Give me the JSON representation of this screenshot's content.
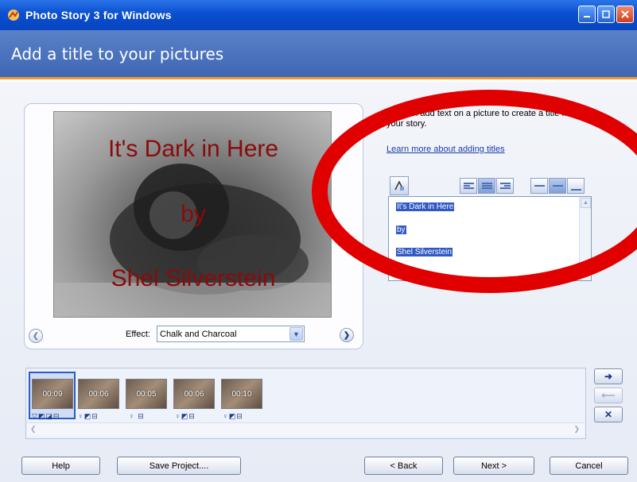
{
  "window": {
    "title": "Photo Story 3 for Windows",
    "header_title": "Add a title to your pictures"
  },
  "preview": {
    "title_lines": [
      "It's Dark in Here",
      "by",
      "Shel Silverstein"
    ],
    "effect_label": "Effect:",
    "effect_value": "Chalk and Charcoal"
  },
  "info": {
    "description": "You can add text on a picture to create a title for your story.",
    "link": "Learn more about adding titles"
  },
  "editor": {
    "lines": [
      "It's Dark in Here",
      "by",
      "Shel Silverstein"
    ]
  },
  "filmstrip": {
    "thumbnails": [
      {
        "time": "00:09",
        "icons": "▽◩◪⊟"
      },
      {
        "time": "00:06",
        "icons": "♀◩⊟"
      },
      {
        "time": "00:05",
        "icons": "♀ ⊟"
      },
      {
        "time": "00:06",
        "icons": "♀◩⊟"
      },
      {
        "time": "00:10",
        "icons": "♀◩⊟"
      }
    ]
  },
  "buttons": {
    "help": "Help",
    "save_project": "Save Project....",
    "back": "< Back",
    "next": "Next >",
    "cancel": "Cancel"
  },
  "colors": {
    "accent": "#3e66b4",
    "title_overlay": "#8b0a0a",
    "annotation": "#e00000"
  }
}
